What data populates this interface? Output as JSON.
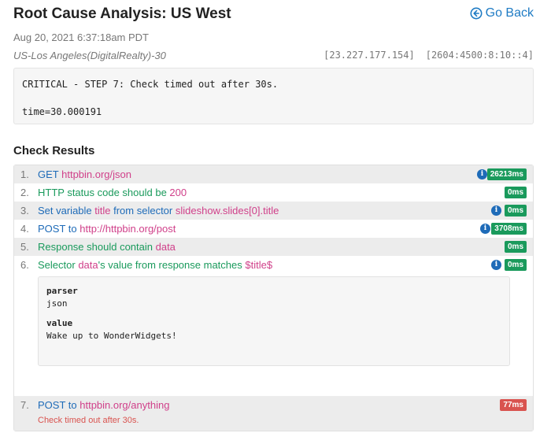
{
  "header": {
    "title": "Root Cause Analysis: US West",
    "go_back": "Go Back",
    "datetime": "Aug 20, 2021 6:37:18am PDT",
    "location": "US-Los Angeles(DigitalRealty)-30",
    "ipv4": "[23.227.177.154]",
    "ipv6": "[2604:4500:8:10::4]"
  },
  "log": {
    "line1": "CRITICAL - STEP 7: Check timed out after 30s.",
    "line2": "time=30.000191"
  },
  "section_title": "Check Results",
  "steps": [
    {
      "num": "1.",
      "parts": [
        "GET ",
        "httpbin.org/json"
      ],
      "badge": "26213ms"
    },
    {
      "num": "2.",
      "parts": [
        "HTTP status code should be ",
        "200"
      ],
      "badge": "0ms"
    },
    {
      "num": "3.",
      "parts": [
        "Set variable ",
        "title",
        " from selector ",
        "slideshow.slides[0].title"
      ],
      "badge": "0ms"
    },
    {
      "num": "4.",
      "parts": [
        "POST to ",
        "http://httpbin.org/post"
      ],
      "badge": "3708ms"
    },
    {
      "num": "5.",
      "parts": [
        "Response should contain ",
        "data"
      ],
      "badge": "0ms"
    },
    {
      "num": "6.",
      "parts": [
        "Selector ",
        "data",
        "'s value from response matches ",
        "$title$"
      ],
      "badge": "0ms"
    },
    {
      "num": "7.",
      "parts": [
        "POST to ",
        "httpbin.org/anything"
      ],
      "badge": "77ms",
      "error": "Check timed out after 30s."
    }
  ],
  "detail": {
    "k1": "parser",
    "v1": "json",
    "k2": "value",
    "v2": "Wake up to WonderWidgets!"
  },
  "colors": {
    "blue": "#1e6bb8",
    "green": "#1a9a5c",
    "pink": "#d0408a",
    "red": "#d9534f"
  },
  "icons": [
    "arrow-circle-left-icon",
    "info-icon"
  ]
}
